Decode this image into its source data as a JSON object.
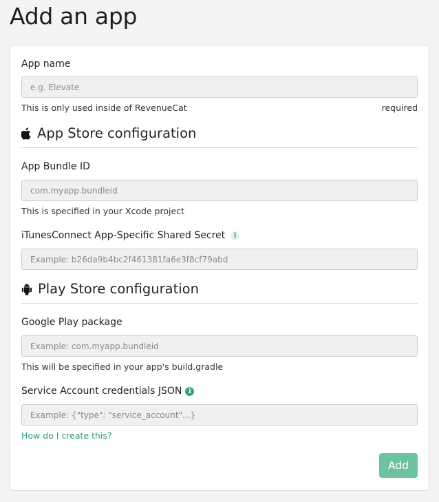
{
  "page": {
    "title": "Add an app"
  },
  "form": {
    "app_name": {
      "label": "App name",
      "placeholder": "e.g. Elevate",
      "help": "This is only used inside of RevenueCat",
      "required": "required"
    },
    "app_store": {
      "title": "App Store configuration",
      "icon": "apple-icon",
      "bundle_id": {
        "label": "App Bundle ID",
        "placeholder": "com.myapp.bundleid",
        "help": "This is specified in your Xcode project"
      },
      "shared_secret": {
        "label": "iTunesConnect App-Specific Shared Secret",
        "info_icon": "i",
        "placeholder": "Example: b26da9b4bc2f461381fa6e3f8cf79abd"
      }
    },
    "play_store": {
      "title": "Play Store configuration",
      "icon": "android-icon",
      "package": {
        "label": "Google Play package",
        "placeholder": "Example: com.myapp.bundleid",
        "help": "This will be specified in your app's build.gradle"
      },
      "credentials": {
        "label": "Service Account credentials JSON",
        "info_icon": "i",
        "placeholder": "Example: {\"type\": \"service_account\"...}",
        "link": "How do I create this?"
      }
    },
    "submit_label": "Add"
  },
  "colors": {
    "accent": "#3aa676",
    "button": "#6cc3a0",
    "link": "#2f9c72"
  }
}
